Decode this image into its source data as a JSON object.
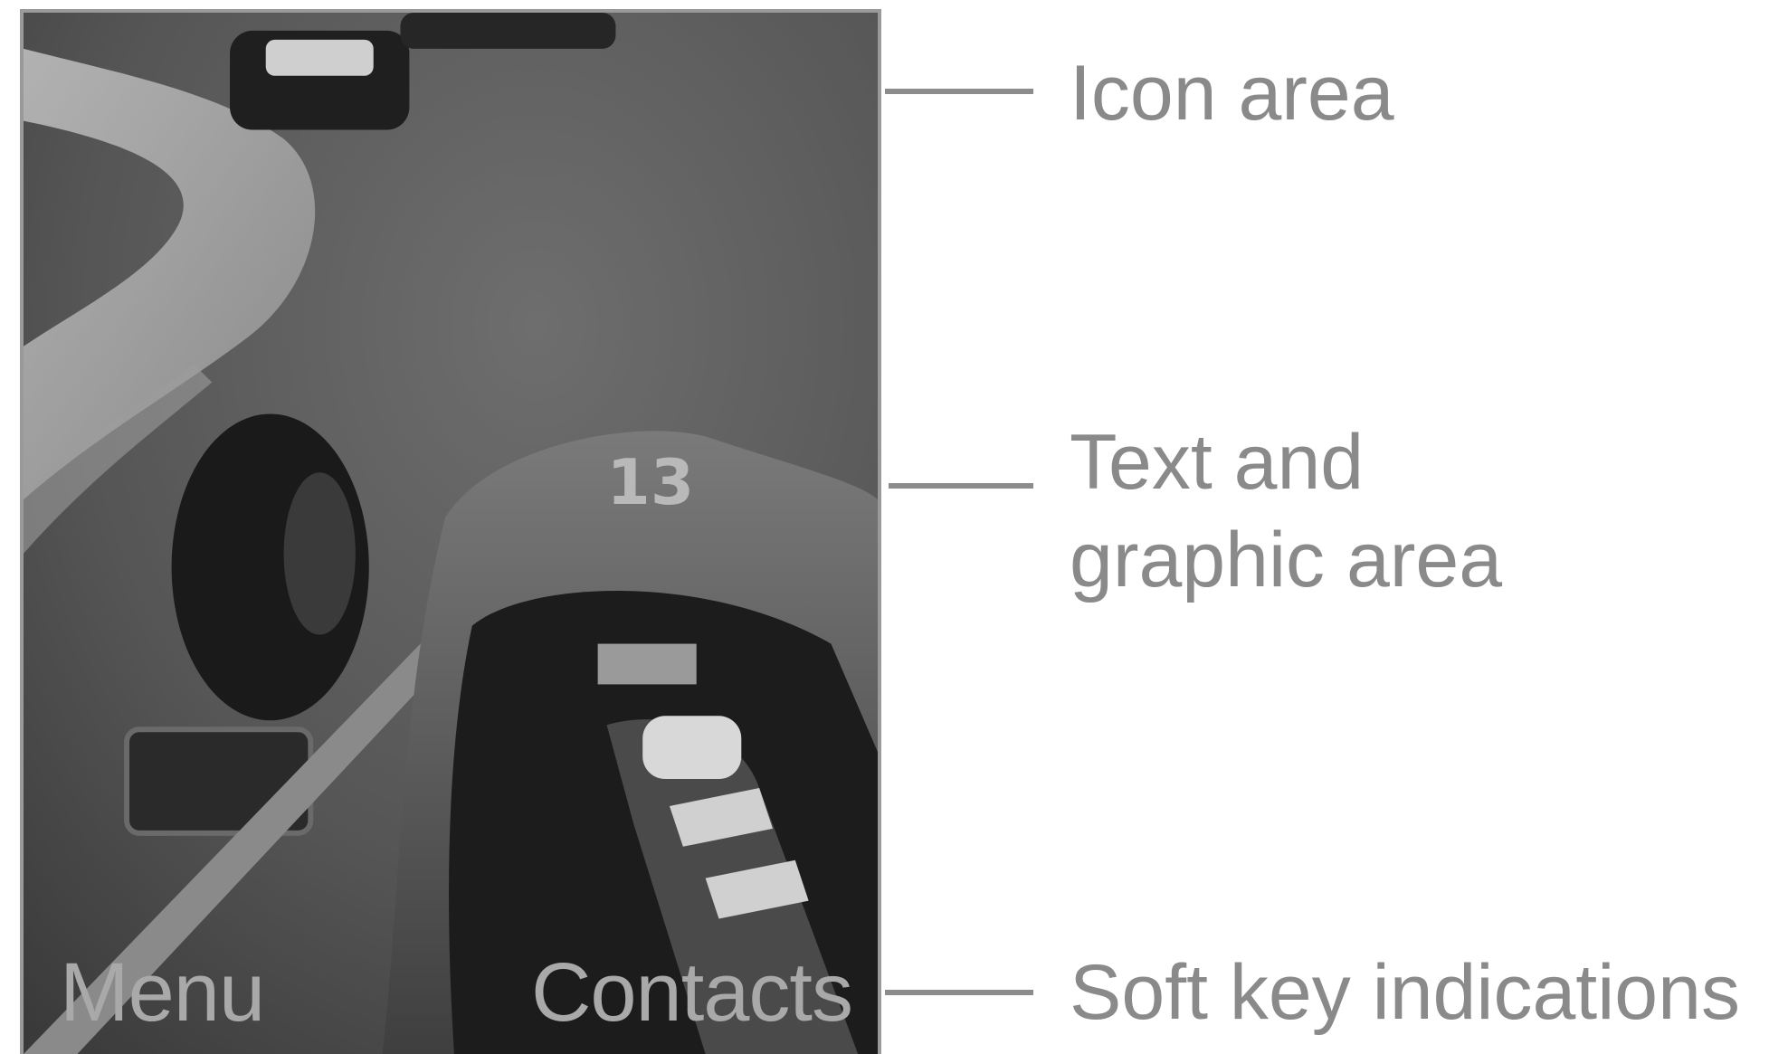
{
  "screen": {
    "softkey_left": "Menu",
    "softkey_right": "Contacts"
  },
  "callouts": {
    "icon_area": "Icon area",
    "text_graphic_area_line1": "Text and",
    "text_graphic_area_line2": "graphic area",
    "soft_key": "Soft key indications"
  },
  "colors": {
    "frame": "#9a9a9a",
    "callout_text": "#8a8a8a",
    "softkey_text": "#a9a9a9"
  }
}
